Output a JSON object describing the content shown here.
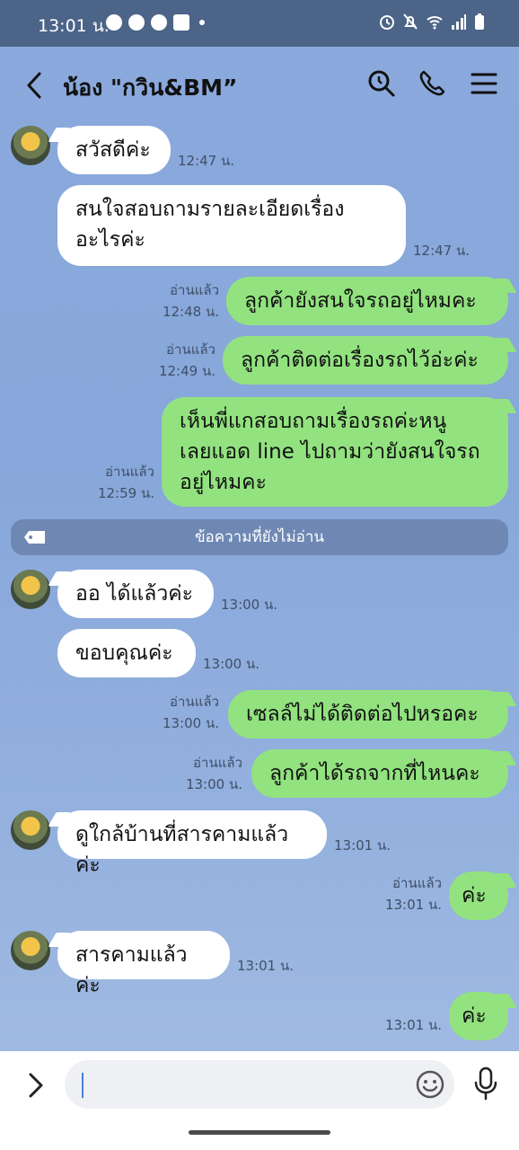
{
  "status": {
    "time": "13:01 น."
  },
  "header": {
    "title": "น้อง \"กวิน&BM”"
  },
  "messages": [
    {
      "dir": "in",
      "text": "สวัสดีค่ะ",
      "time": "12:47 น."
    },
    {
      "dir": "in",
      "text": "สนใจสอบถามรายละเอียดเรื่อง\nอะไรค่ะ",
      "time": "12:47 น."
    },
    {
      "dir": "out",
      "text": "ลูกค้ายังสนใจรถอยู่ไหมคะ",
      "read": "อ่านแล้ว",
      "time": "12:48 น."
    },
    {
      "dir": "out",
      "text": "ลูกค้าติดต่อเรื่องรถไว้อ่ะค่ะ",
      "read": "อ่านแล้ว",
      "time": "12:49 น."
    },
    {
      "dir": "out",
      "text": "เห็นพี่แกสอบถามเรื่องรถค่ะหนู\nเลยแอด line ไปถามว่ายังสนใจรถ\nอยู่ไหมคะ",
      "read": "อ่านแล้ว",
      "time": "12:59 น."
    },
    {
      "dir": "in",
      "text": "ออ ได้แล้วค่ะ",
      "time": "13:00 น."
    },
    {
      "dir": "in",
      "text": "ขอบคุณค่ะ",
      "time": "13:00 น."
    },
    {
      "dir": "out",
      "text": "เซลล์ไม่ได้ติดต่อไปหรอคะ",
      "read": "อ่านแล้ว",
      "time": "13:00 น."
    },
    {
      "dir": "out",
      "text": "ลูกค้าได้รถจากที่ไหนคะ",
      "read": "อ่านแล้ว",
      "time": "13:00 น."
    },
    {
      "dir": "in",
      "text": "ดูใกล้บ้านที่สารคามแล้วค่ะ",
      "time": "13:01 น."
    },
    {
      "dir": "out",
      "text": "ค่ะ",
      "read": "อ่านแล้ว",
      "time": "13:01 น."
    },
    {
      "dir": "in",
      "text": "สารคามแล้วค่ะ",
      "time": "13:01 น."
    },
    {
      "dir": "out",
      "text": "ค่ะ",
      "time": "13:01 น."
    }
  ],
  "unread_divider": "ข้อความที่ยังไม่อ่าน",
  "colors": {
    "incoming_bubble": "#ffffff",
    "outgoing_bubble": "#92e27f",
    "status_bar": "#4b6488",
    "chat_background": "#8aa9dc"
  },
  "icons": [
    "back-icon",
    "search-icon",
    "phone-icon",
    "menu-icon",
    "expand-icon",
    "emoji-icon",
    "mic-icon",
    "tag-icon"
  ]
}
